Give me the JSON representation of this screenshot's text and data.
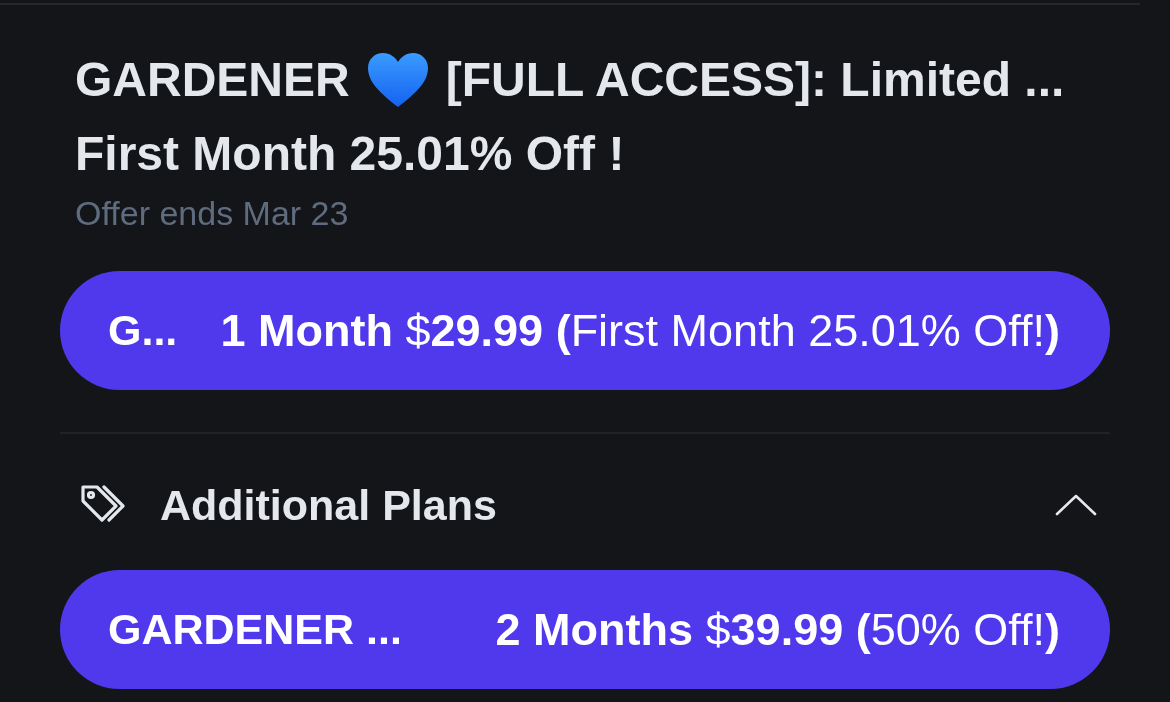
{
  "offer": {
    "title_parts": [
      "GARDENER",
      "[FULL ACCESS]: Limited ..."
    ],
    "headline": "First Month 25.01% Off !",
    "expiry": "Offer ends Mar 23"
  },
  "main_plan": {
    "name": "G...",
    "details": "**1 Month** $**29.99** **(**First Month 25.01% Off!**)**"
  },
  "additional_plans": {
    "title": "Additional Plans",
    "expanded": true,
    "plans": [
      {
        "name": "GARDENER ...",
        "details": "**2 Months** $**39.99** **(**50% Off!**)**"
      }
    ]
  }
}
